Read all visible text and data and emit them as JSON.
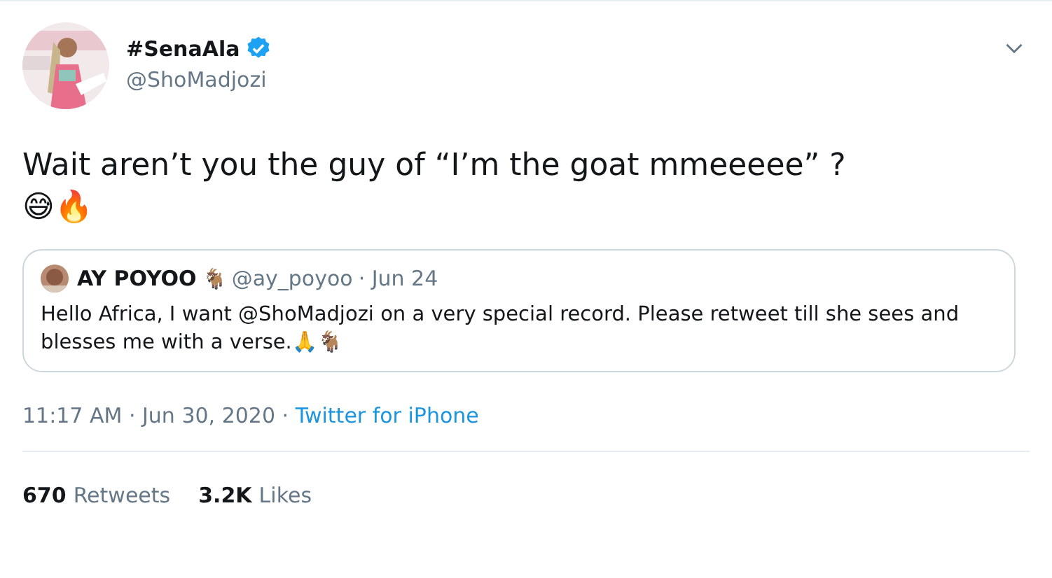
{
  "author": {
    "name": "#SenaAla",
    "verified": true,
    "handle": "@ShoMadjozi"
  },
  "tweet": {
    "text": "Wait aren’t you the guy of “I’m the goat mmeeeee” ?",
    "emoji": "😅🔥"
  },
  "quote": {
    "name": "AY POYOO",
    "name_emoji": "🐐",
    "handle": "@ay_poyoo",
    "date": "· Jun 24",
    "text": "Hello Africa, I want @ShoMadjozi on a very special record. Please retweet till she sees and blesses me with a verse.🙏🐐"
  },
  "meta": {
    "time": "11:17 AM · Jun 30, 2020 · ",
    "source": "Twitter for iPhone"
  },
  "stats": [
    {
      "count": "670",
      "label": "Retweets"
    },
    {
      "count": "3.2K",
      "label": "Likes"
    }
  ]
}
